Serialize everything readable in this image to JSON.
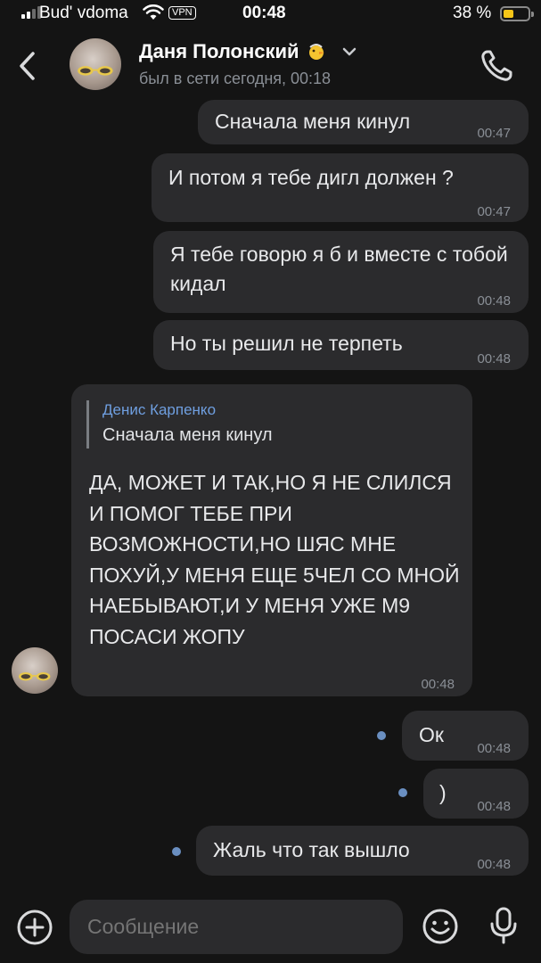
{
  "status_bar": {
    "carrier": "Bud' vdoma",
    "vpn": "VPN",
    "time": "00:48",
    "battery": "38 %",
    "battery_level": 0.38
  },
  "header": {
    "contact_name": "Даня Полонский",
    "last_seen": "был в сети сегодня, 00:18"
  },
  "messages": [
    {
      "text": "Сначала меня кинул",
      "time": "00:47"
    },
    {
      "text": "И потом я тебе дигл должен ?",
      "time": "00:47"
    },
    {
      "text": "Я тебе говорю я б и вместе с тобой кидал",
      "time": "00:48"
    },
    {
      "text": "Но ты решил не терпеть",
      "time": "00:48"
    },
    {
      "reply_author": "Денис Карпенко",
      "reply_text": "Сначала меня кинул",
      "text": "ДА, МОЖЕТ И ТАК,НО Я НЕ СЛИЛСЯ И ПОМОГ ТЕБЕ ПРИ ВОЗМОЖНОСТИ,НО ШЯС МНЕ ПОХУЙ,У МЕНЯ ЕЩЕ 5ЧЕЛ СО МНОЙ НАЕБЫВАЮТ,И У МЕНЯ УЖЕ М9\nПОСАСИ ЖОПУ",
      "time": "00:48"
    },
    {
      "text": "Ок",
      "time": "00:48"
    },
    {
      "text": ")",
      "time": "00:48"
    },
    {
      "text": "Жаль что так вышло",
      "time": "00:48"
    }
  ],
  "composer": {
    "placeholder": "Сообщение"
  },
  "icons": {
    "back": "chevron-left-icon",
    "call": "phone-icon",
    "attach": "plus-circle-icon",
    "emoji": "smile-icon",
    "voice": "microphone-icon",
    "unread": "dot-icon"
  },
  "colors": {
    "background": "#141414",
    "bubble": "#2b2b2d",
    "accent": "#6f9fe0",
    "unread_dot": "#6a8fc1",
    "battery_fill": "#f5c518"
  }
}
